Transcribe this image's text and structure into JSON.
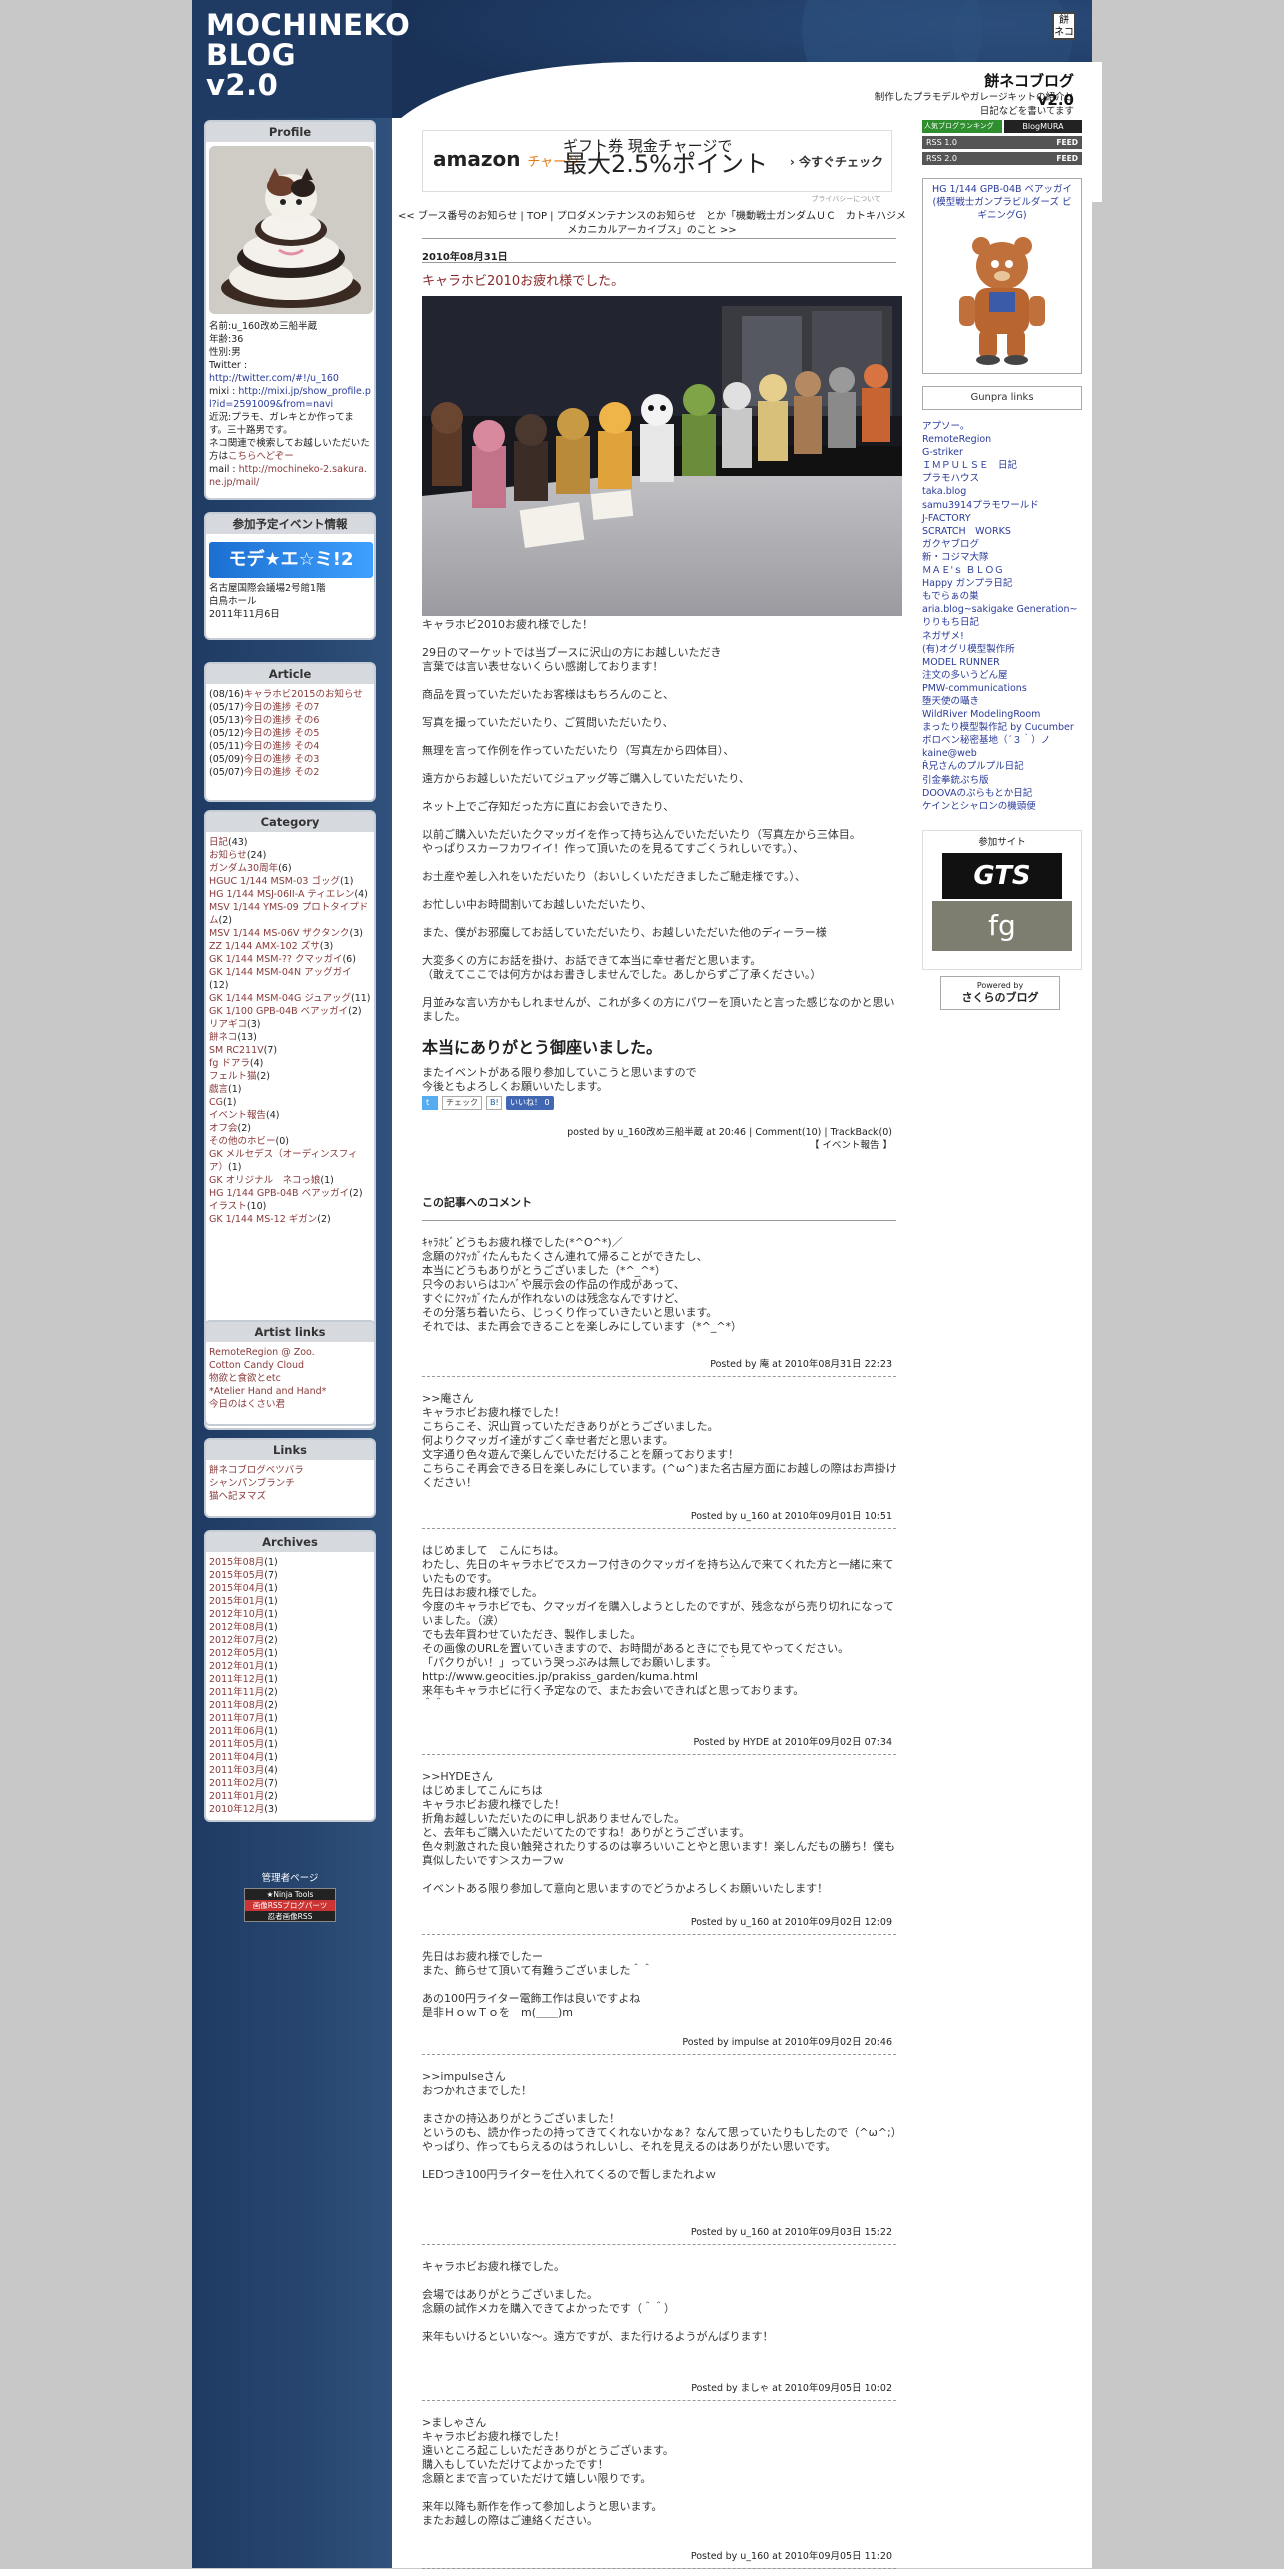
{
  "header": {
    "logo_line1": "MOCHINEKO",
    "logo_line2": "BLOG",
    "logo_line3": "v2.0",
    "badge": "餅\nネコ",
    "title": "餅ネコブログv2.0",
    "description": "制作したプラモデルやガレージキットの紹介と\n日記などを書いてます"
  },
  "profile": {
    "heading": "Profile",
    "name": "名前:u_160改め三船半蔵",
    "age": "年齢:36",
    "sex": "性別:男",
    "twitter_label": "Twitter : ",
    "twitter": "http://twitter.com/#!/u_160",
    "mixi_label": "mixi : ",
    "mixi": "http://mixi.jp/show_profile.pl?id=2591009&from=navi",
    "text1": "近況:プラモ、ガレキとか作ってます。三十路男です。",
    "text2": "ネコ関連で検索してお越しいただいた方は",
    "text2_link": "こちらへどぞー",
    "mail_label": "mail : ",
    "mail": "http://mochineko-2.sakura.ne.jp/mail/"
  },
  "event": {
    "heading": "参加予定イベント情報",
    "banner": "モデ★エ☆ミ!2",
    "venue": "名古屋国際会議場2号館1階\n白鳥ホール",
    "date": "2011年11月6日"
  },
  "articles": {
    "heading": "Article",
    "items": [
      {
        "date": "(08/16)",
        "title": "キャラホビ2015のお知らせ"
      },
      {
        "date": "(05/17)",
        "title": "今日の進捗 その7"
      },
      {
        "date": "(05/13)",
        "title": "今日の進捗 その6"
      },
      {
        "date": "(05/12)",
        "title": "今日の進捗 その5"
      },
      {
        "date": "(05/11)",
        "title": "今日の進捗 その4"
      },
      {
        "date": "(05/09)",
        "title": "今日の進捗 その3"
      },
      {
        "date": "(05/07)",
        "title": "今日の進捗 その2"
      }
    ]
  },
  "category": {
    "heading": "Category",
    "items": [
      {
        "label": "日記",
        "count": "(43)"
      },
      {
        "label": "お知らせ",
        "count": "(24)"
      },
      {
        "label": "ガンダム30周年",
        "count": "(6)"
      },
      {
        "label": "HGUC 1/144 MSM-03 ゴッグ",
        "count": "(1)"
      },
      {
        "label": "HG 1/144 MSJ-06II-A ティエレン",
        "count": "(4)"
      },
      {
        "label": "MSV 1/144 YMS-09 プロトタイプドム",
        "count": "(2)"
      },
      {
        "label": "MSV 1/144 MS-06V ザクタンク",
        "count": "(3)"
      },
      {
        "label": "ZZ 1/144 AMX-102 ズサ",
        "count": "(3)"
      },
      {
        "label": "GK 1/144 MSM-?? クマッガイ",
        "count": "(6)"
      },
      {
        "label": "GK 1/144 MSM-04N アッグガイ",
        "count": "(12)"
      },
      {
        "label": "GK 1/144 MSM-04G ジュアッグ",
        "count": "(11)"
      },
      {
        "label": "GK 1/100 GPB-04B ベアッガイ",
        "count": "(2)"
      },
      {
        "label": "リアギコ",
        "count": "(3)"
      },
      {
        "label": "餅ネコ",
        "count": "(13)"
      },
      {
        "label": "SM RC211V",
        "count": "(7)"
      },
      {
        "label": "fg ドアラ",
        "count": "(4)"
      },
      {
        "label": "フェルト猫",
        "count": "(2)"
      },
      {
        "label": "戯言",
        "count": "(1)"
      },
      {
        "label": "CG",
        "count": "(1)"
      },
      {
        "label": "イベント報告",
        "count": "(4)"
      },
      {
        "label": "オフ会",
        "count": "(2)"
      },
      {
        "label": "その他のホビー",
        "count": "(0)"
      },
      {
        "label": "GK メルセデス（オーディンスフィア）",
        "count": "(1)"
      },
      {
        "label": "GK オリジナル　ネコっ娘",
        "count": "(1)"
      },
      {
        "label": "HG 1/144 GPB-04B ベアッガイ",
        "count": "(2)"
      },
      {
        "label": "イラスト",
        "count": "(10)"
      },
      {
        "label": "GK 1/144 MS-12 ギガン",
        "count": "(2)"
      }
    ]
  },
  "artist_links": {
    "heading": "Artist links",
    "items": [
      "RemoteRegion @ Zoo.",
      "Cotton Candy Cloud",
      "物欲と食欲とetc",
      "*Atelier Hand and Hand*",
      "今日のはくさい君"
    ]
  },
  "links": {
    "heading": "Links",
    "items": [
      "餅ネコブログベツバラ",
      "シャンパンブランチ",
      "猫ヘ記ヌマズ"
    ]
  },
  "archives": {
    "heading": "Archives",
    "items": [
      {
        "month": "2015年08月",
        "count": "(1)"
      },
      {
        "month": "2015年05月",
        "count": "(7)"
      },
      {
        "month": "2015年04月",
        "count": "(1)"
      },
      {
        "month": "2015年01月",
        "count": "(1)"
      },
      {
        "month": "2012年10月",
        "count": "(1)"
      },
      {
        "month": "2012年08月",
        "count": "(1)"
      },
      {
        "month": "2012年07月",
        "count": "(2)"
      },
      {
        "month": "2012年05月",
        "count": "(1)"
      },
      {
        "month": "2012年01月",
        "count": "(1)"
      },
      {
        "month": "2011年12月",
        "count": "(1)"
      },
      {
        "month": "2011年11月",
        "count": "(2)"
      },
      {
        "month": "2011年08月",
        "count": "(2)"
      },
      {
        "month": "2011年07月",
        "count": "(1)"
      },
      {
        "month": "2011年06月",
        "count": "(1)"
      },
      {
        "month": "2011年05月",
        "count": "(1)"
      },
      {
        "month": "2011年04月",
        "count": "(1)"
      },
      {
        "month": "2011年03月",
        "count": "(4)"
      },
      {
        "month": "2011年02月",
        "count": "(7)"
      },
      {
        "month": "2011年01月",
        "count": "(2)"
      },
      {
        "month": "2010年12月",
        "count": "(3)"
      }
    ]
  },
  "admin": {
    "label": "管理者ページ",
    "ninja": "★Ninja Tools",
    "ninja2": "画像RSSブログパーツ",
    "ninja3": "忍者画像RSS"
  },
  "ad": {
    "brand": "amazon",
    "brand_sub": "チャージ",
    "line1": "ギフト券 現金チャージで",
    "line2": "最大2.5%ポイント",
    "check": "› 今すぐチェック",
    "privacy": "プライバシーについて"
  },
  "nav": {
    "text": "<< ブース番号のお知らせ | TOP | プロダメンテナンスのお知らせ　とか「機動戦士ガンダムＵＣ　カトキハジメ メカニカルアーカイブス」のこと >>"
  },
  "post": {
    "date": "2010年08月31日",
    "title": "キャラホビ2010お疲れ様でした。",
    "body": "キャラホビ2010お疲れ様でした！\n\n29日のマーケットでは当ブースに沢山の方にお越しいただき\n言葉では言い表せないくらい感謝しております！\n\n商品を買っていただいたお客様はもちろんのこと、\n\n写真を撮っていただいたり、ご質問いただいたり、\n\n無理を言って作例を作っていただいたり（写真左から四体目）、\n\n遠方からお越しいただいてジュアッグ等ご購入していただいたり、\n\nネット上でご存知だった方に直にお会いできたり、\n\n以前ご購入いただいたクマッガイを作って持ち込んでいただいたり（写真左から三体目。\nやっぱりスカーフカワイイ！作って頂いたのを見るてすごくうれしいです。）、\n\nお土産や差し入れをいただいたり（おいしくいただきましたご馳走様です。）、\n\nお忙しい中お時間割いてお越しいただいたり、\n\nまた、僕がお邪魔してお話していただいたり、お越しいただいた他のディーラー様\n\n大変多くの方にお話を掛け、お話できて本当に幸せ者だと思います。\n（敢えてここでは何方かはお書きしませんでした。あしからずご了承ください。）\n\n月並みな言い方かもしれませんが、これが多くの方にパワーを頂いたと言った感じなのかと思いました。",
    "big": "本当にありがとう御座いました。",
    "body2": "またイベントがある限り参加していこうと思いますので\n今後ともよろしくお願いいたします。",
    "check": "チェック",
    "like": "いいね！ 0",
    "posted": "posted by u_160改め三船半蔵 at 20:46 | Comment(10) | TrackBack(0)",
    "category": "【 イベント報告 】"
  },
  "comments": {
    "heading": "この記事へのコメント",
    "items": [
      {
        "text": "ｷｬﾗﾎﾋﾞどうもお疲れ様でした(*^O^*)／\n念願のｸﾏｯｶﾞｲたんもたくさん連れて帰ることができたし、\n本当にどうもありがとうございました（*^_^*）\n只今のおいらはｺﾝﾍﾞや展示会の作品の作成があって、\nすぐにｸﾏｯｶﾞｲたんが作れないのは残念なんですけど、\nその分落ち着いたら、じっくり作っていきたいと思います。\nそれでは、また再会できることを楽しみにしています（*^_^*）",
        "by": "Posted by 庵 at 2010年08月31日 22:23"
      },
      {
        "text": ">>庵さん\nキャラホビお疲れ様でした！\nこちらこそ、沢山買っていただきありがとうございました。\n何よりクマッガイ達がすごく幸せ者だと思います。\n文字通り色々遊んで楽しんでいただけることを願っております！\nこちらこそ再会できる日を楽しみにしています。(^ω^)また名古屋方面にお越しの際はお声掛けください！",
        "by": "Posted by u_160 at 2010年09月01日 10:51"
      },
      {
        "text": "はじめまして　こんにちは。\nわたし、先日のキャラホビでスカーフ付きのクマッガイを持ち込んで来てくれた方と一緒に来ていたものです。\n先日はお疲れ様でした。\n今度のキャラホビでも、クマッガイを購入しようとしたのですが、残念ながら売り切れになっていました。（涙）\nでも去年買わせていただき、製作しました。\nその画像のURLを置いていきますので、お時間があるときにでも見てやってください。\n「パクりがい！」っていう哭っぷみは無しでお願いします。＾＾\nhttp://www.geocities.jp/prakiss_garden/kuma.html\n来年もキャラホビに行く予定なので、またお会いできればと思っております。\n＾＾",
        "by": "Posted by HYDE at 2010年09月02日 07:34"
      },
      {
        "text": ">>HYDEさん\nはじめましてこんにちは\nキャラホビお疲れ様でした！\n折角お越しいただいたのに申し訳ありませんでした。\nと、去年もご購入いただいてたのですね！ありがとうございます。\n色々刺激された良い触発されたりするのは寧ろいいことやと思います！楽しんだもの勝ち！僕も真似したいです＞スカーフｗ\n\nイベントある限り参加して意向と思いますのでどうかよろしくお願いいたします！",
        "by": "Posted by u_160 at 2010年09月02日 12:09"
      },
      {
        "text": "先日はお疲れ様でしたー\nまた、飾らせて頂いて有難うございました＾＾\n\nあの100円ライター電飾工作は良いですよね\n是非ＨｏｗＴｏを　m(＿＿)m",
        "by": "Posted by impulse at 2010年09月02日 20:46"
      },
      {
        "text": ">>impulseさん\nおつかれさまでした！\n\nまさかの持込ありがとうございました！\nというのも、読か作ったの持ってきてくれないかなぁ？なんて思っていたりもしたので（^ω^;）\nやっぱり、作ってもらえるのはうれしいし、それを見えるのはありがたい思いです。\n\nLEDつき100円ライターを仕入れてくるので暫しまたれよｗ",
        "by": "Posted by u_160 at 2010年09月03日 15:22"
      },
      {
        "text": "キャラホビお疲れ様でした。\n\n会場ではありがとうございました。\n念願の試作メカを購入できてよかったです（＾＾）\n\n来年もいけるといいな～。遠方ですが、また行けるようがんばります！",
        "by": "Posted by ましゃ at 2010年09月05日 10:02"
      },
      {
        "text": ">ましゃさん\nキャラホビお疲れ様でした！\n遠いところ起こしいただきありがとうございます。\n購入もしていただけてよかったです！\n念願とまで言っていただけて嬉しい限りです。\n\n来年以降も新作を作って参加しようと思います。\nまたお越しの際はご連絡ください。",
        "by": "Posted by u_160 at 2010年09月05日 11:20"
      }
    ]
  },
  "right": {
    "rss1": "RSS 1.0",
    "rss2": "RSS 2.0",
    "feed": "FEED",
    "rank1": "人気ブログランキング",
    "rank2": "BlogMURA",
    "feature_title": "HG 1/144 GPB-04B ベアッガイ(模型戦士ガンプラビルダーズ ビギニングG)",
    "gunpra_heading": "Gunpra links",
    "gunpra": [
      "アプソー。",
      "RemoteRegion",
      "G-striker",
      "ＩＭＰＵＬＳＥ　日記",
      "プラモハウス",
      "taka.blog",
      "samu3914プラモワールド",
      "J-FACTORY",
      "SCRATCH　WORKS",
      "ガクヤブログ",
      "新・コジマ大隊",
      "ＭＡＥ'ｓ ＢＬＯＧ",
      "Happy ガンプラ日記",
      "もでらぁの巣",
      "aria.blog~sakigake Generation~",
      "りりもち日記",
      "ネガザメ!",
      "(有)オグリ模型製作所",
      "MODEL RUNNER",
      "注文の多いうどん屋",
      "PMW-communications",
      "堕天使の囁き",
      "WildRiver ModelingRoom",
      "まったり模型製作記 by Cucumber",
      "ボロベン秘密基地（´３｀）ノ",
      "kaine@web",
      "Ř兄さんのプルプル日記",
      "引金拳銃ぷち版",
      "DOOVAのぷらもとか日記",
      "ケインとシャロンの機頭便"
    ],
    "sites_heading": "参加サイト",
    "site1": "GTS",
    "site2": "fg",
    "powered": "Powered by",
    "sakura": "さくらのブログ"
  },
  "colors": {
    "navy": "#1f3b64",
    "link": "#2a3b9a",
    "title_red": "#8a2828"
  }
}
